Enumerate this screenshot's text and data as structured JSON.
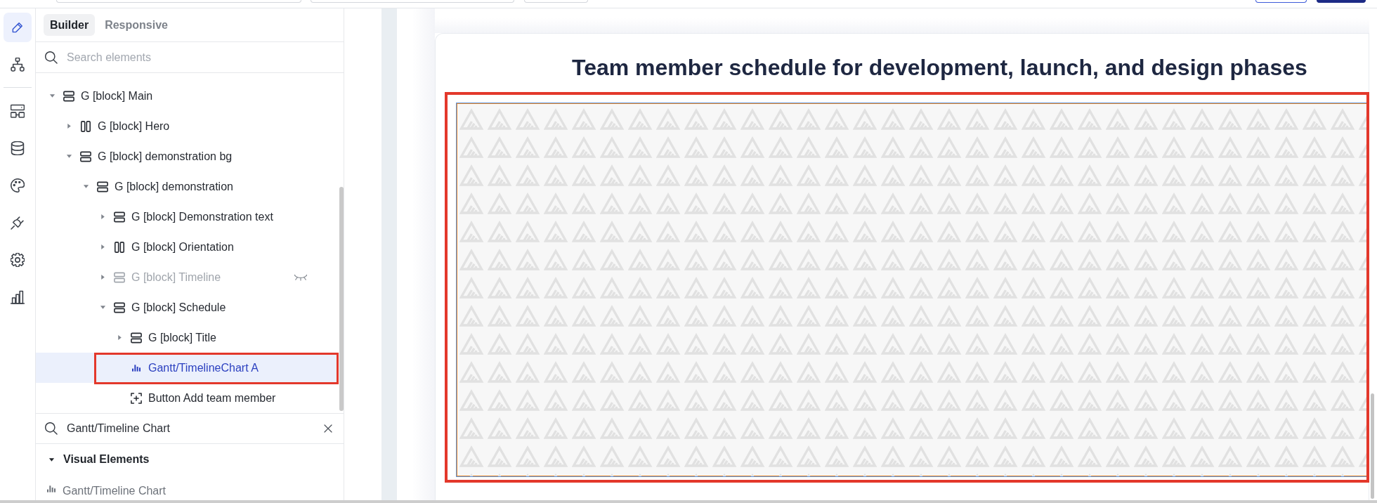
{
  "top_bar": {
    "controls": [
      {
        "kind": "field"
      },
      {
        "kind": "field"
      },
      {
        "kind": "button"
      },
      {
        "kind": "outline_button"
      },
      {
        "kind": "primary_button"
      }
    ]
  },
  "rail": {
    "groups": [
      {
        "items": [
          {
            "selected": true
          },
          {
            "selected": false
          }
        ]
      },
      {
        "items": [
          {
            "selected": false
          },
          {
            "selected": false
          },
          {
            "selected": false
          },
          {
            "selected": false
          },
          {
            "selected": false
          },
          {
            "selected": false
          }
        ]
      }
    ]
  },
  "panel": {
    "tabs": [
      {
        "label": "Builder",
        "selected": true
      },
      {
        "label": "Responsive",
        "selected": false
      }
    ],
    "search": {
      "placeholder": "Search elements"
    },
    "tree": [
      {
        "label": "G [block] Main",
        "kind": "stack",
        "expanded": true,
        "selected": false,
        "hidden": false,
        "highlighted": false,
        "children": [
          {
            "label": "G [block] Hero",
            "kind": "columns",
            "expanded": false,
            "selected": false,
            "hidden": false,
            "highlighted": false
          },
          {
            "label": "G [block] demonstration bg",
            "kind": "stack",
            "expanded": true,
            "selected": false,
            "hidden": false,
            "highlighted": false,
            "children": [
              {
                "label": "G [block] demonstration",
                "kind": "stack",
                "expanded": true,
                "selected": false,
                "hidden": false,
                "highlighted": false,
                "children": [
                  {
                    "label": "G [block] Demonstration text",
                    "kind": "stack",
                    "expanded": false,
                    "selected": false,
                    "hidden": false,
                    "highlighted": false
                  },
                  {
                    "label": "G [block] Orientation",
                    "kind": "columns",
                    "expanded": false,
                    "selected": false,
                    "hidden": false,
                    "highlighted": false
                  },
                  {
                    "label": "G [block] Timeline",
                    "kind": "stack",
                    "expanded": false,
                    "selected": false,
                    "hidden": true,
                    "highlighted": false
                  },
                  {
                    "label": "G [block] Schedule",
                    "kind": "stack",
                    "expanded": true,
                    "selected": false,
                    "hidden": false,
                    "highlighted": false,
                    "children": [
                      {
                        "label": "G [block] Title",
                        "kind": "stack",
                        "expanded": false,
                        "selected": false,
                        "hidden": false,
                        "highlighted": false
                      },
                      {
                        "label": "Gantt/TimelineChart A",
                        "kind": "chart",
                        "selected": true,
                        "hidden": false,
                        "highlighted": true
                      },
                      {
                        "label": "Button Add team member",
                        "kind": "button",
                        "selected": false,
                        "hidden": false,
                        "highlighted": false
                      }
                    ]
                  }
                ]
              }
            ]
          }
        ]
      }
    ],
    "library_search": {
      "value": "Gantt/Timeline Chart"
    },
    "library": [
      {
        "label": "Visual Elements",
        "expanded": true,
        "items": [
          {
            "label": "Gantt/Timeline Chart"
          }
        ]
      }
    ]
  },
  "canvas": {
    "title": "Team member schedule for development, launch, and design phases",
    "chart": {
      "highlighted": true
    }
  }
}
